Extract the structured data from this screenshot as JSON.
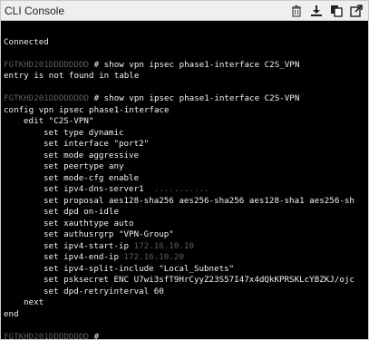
{
  "window": {
    "title": "CLI Console"
  },
  "toolbar": {
    "icons": [
      "trash-icon",
      "download-icon",
      "copy-icon",
      "expand-icon"
    ]
  },
  "terminal": {
    "connected": "Connected",
    "prompt1_host": "FGTKHD201DDDDDDDD",
    "prompt1_cmd": " # show vpn ipsec phase1-interface C2S_VPN",
    "error_line": "entry is not found in table",
    "prompt2_host": "FGTKHD201DDDDDDDD",
    "prompt2_cmd": " # show vpn ipsec phase1-interface C2S-VPN",
    "config_line": "config vpn ipsec phase1-interface",
    "edit_line": "edit \"C2S-VPN\"",
    "settings": [
      "set type dynamic",
      "set interface \"port2\"",
      "set mode aggressive",
      "set peertype any",
      "set mode-cfg enable"
    ],
    "dns_line": "set ipv4-dns-server1",
    "dns_masked": "  ...........",
    "settings2": [
      "set proposal aes128-sha256 aes256-sha256 aes128-sha1 aes256-sh",
      "set dpd on-idle",
      "set xauthtype auto",
      "set authusrgrp \"VPN-Group\""
    ],
    "start_ip_line": "set ipv4-start-ip",
    "start_ip_masked": " 172.16.10.10",
    "end_ip_line": "set ipv4-end-ip",
    "end_ip_masked": " 172.16.10.20",
    "settings3": [
      "set ipv4-split-include \"Local_Subnets\"",
      "set psksecret ENC U7wi3sfT9HrCyyZ23S57I47x4dQkKPRSKLcYBZKJ/ojc",
      "set dpd-retryinterval 60"
    ],
    "next_line": "next",
    "end_line": "end",
    "prompt3_host": "FGTKHD201DDDDDDDD",
    "prompt3_cmd": " #"
  }
}
